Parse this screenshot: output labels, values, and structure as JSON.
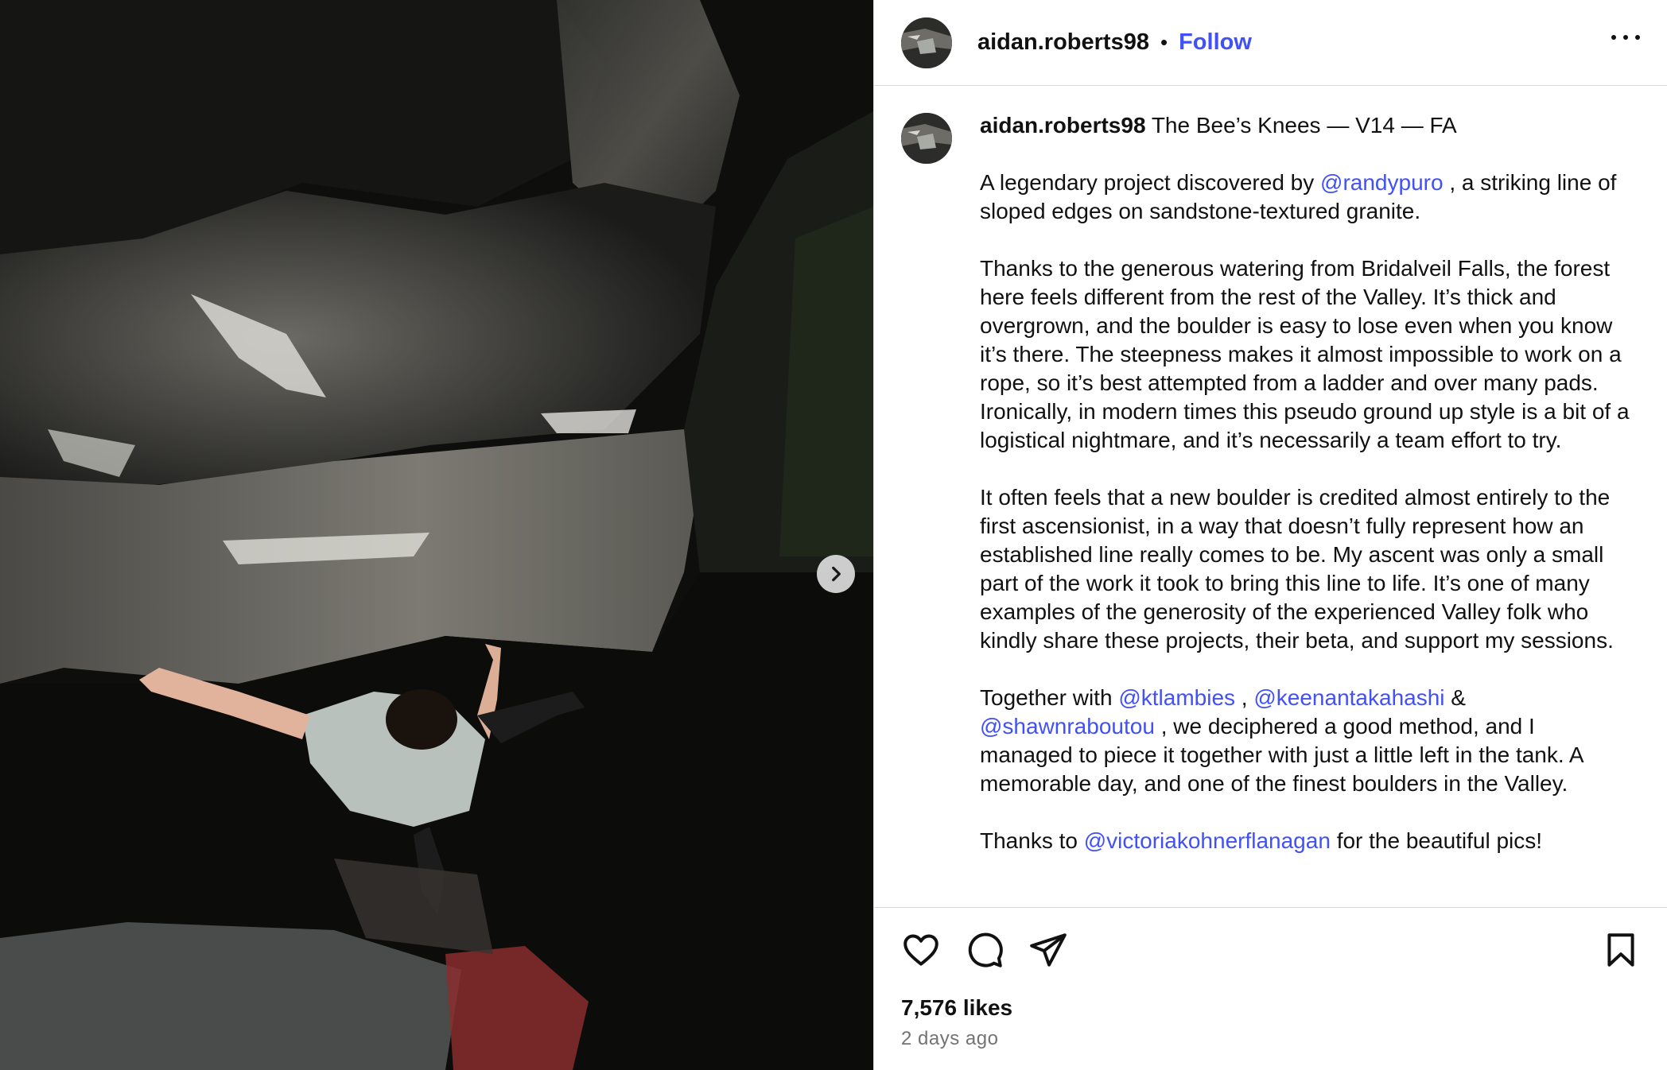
{
  "post": {
    "username": "aidan.roberts98",
    "separator": "•",
    "follow_label": "Follow",
    "more_icon": "more-horizontal-icon"
  },
  "photo": {
    "next_icon": "chevron-right-icon"
  },
  "caption": {
    "username": "aidan.roberts98",
    "title": "The Bee’s Knees — V14 — FA",
    "p1_a": "A legendary project discovered by",
    "p1_mention": "@randypuro",
    "p1_b": ", a striking line of sloped edges on sandstone-textured granite.",
    "p2": "Thanks to the generous watering from Bridalveil Falls, the forest here feels different from the rest of the Valley. It’s thick and overgrown, and the boulder is easy to lose even when you know it’s there. The steepness makes it almost impossible to work on a rope, so it’s best attempted from a ladder and over many pads. Ironically, in modern times this pseudo ground up style is a bit of a logistical nightmare, and it’s necessarily a team effort to try.",
    "p3": "It often feels that a new boulder is credited almost entirely to the first ascensionist, in a way that doesn’t fully represent how an established line really comes to be. My ascent was only a small part of the work it took to bring this line to life. It’s one of many examples of the generosity of the experienced Valley folk who kindly share these projects, their beta, and support my sessions.",
    "p4_a": "Together with",
    "p4_m1": "@ktlambies",
    "p4_sep1": ",",
    "p4_m2": "@keenantakahashi",
    "p4_sep2": "&",
    "p4_m3": "@shawnraboutou",
    "p4_b": ", we deciphered a good method, and I managed to piece it together with just a little left in the tank. A memorable day, and one of the finest boulders in the Valley.",
    "p5_a": "Thanks to",
    "p5_mention": "@victoriakohnerflanagan",
    "p5_b": "for the beautiful pics!"
  },
  "actions": {
    "like_icon": "heart-icon",
    "comment_icon": "comment-icon",
    "share_icon": "send-icon",
    "save_icon": "bookmark-icon"
  },
  "stats": {
    "likes": "7,576 likes",
    "time": "2 days ago"
  },
  "colors": {
    "link": "#4150f7",
    "text": "#111111",
    "muted": "#737373",
    "border": "#dbdbdb"
  }
}
